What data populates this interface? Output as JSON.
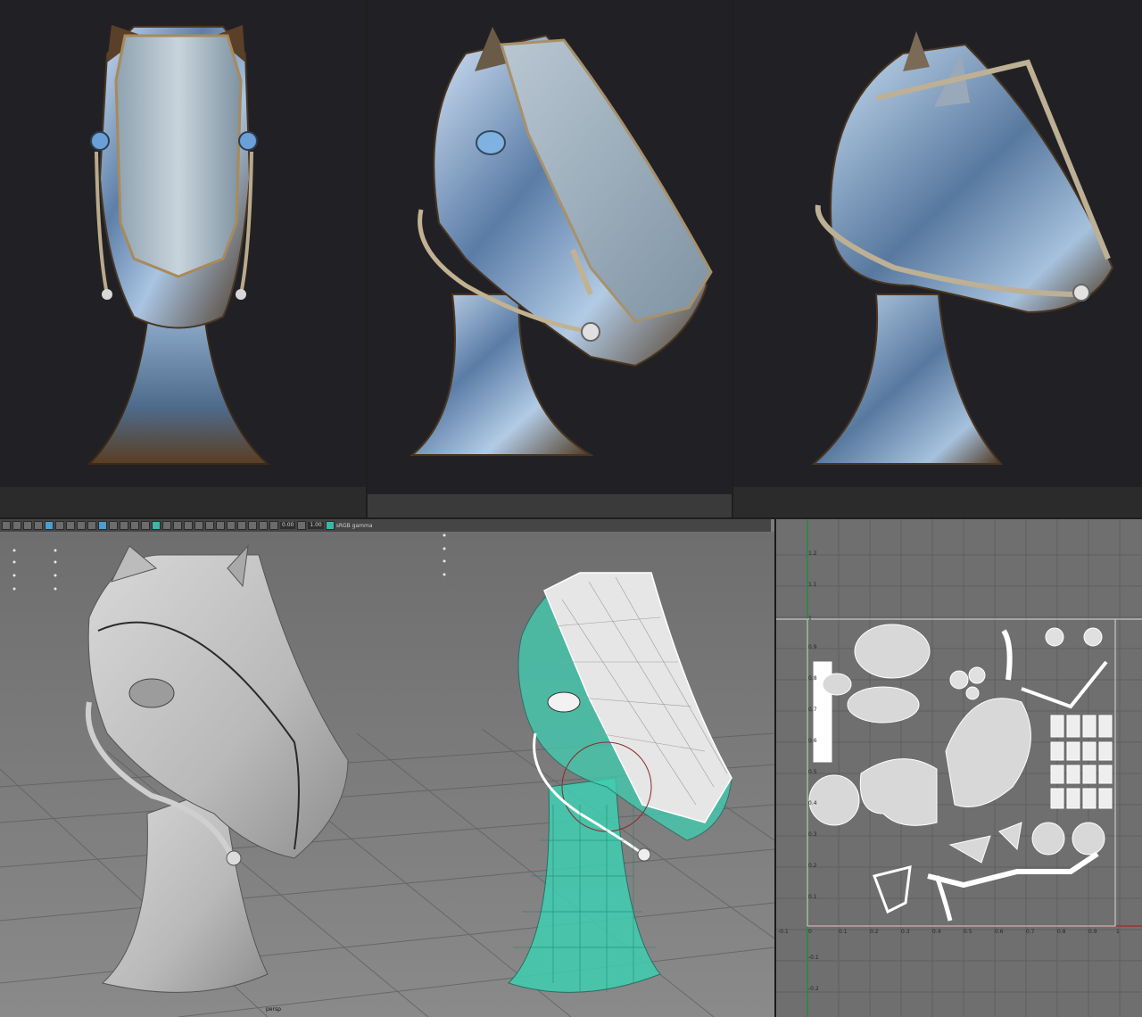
{
  "toolbar": {
    "field_exposure": "0.00",
    "field_gamma": "1.00",
    "color_space": "sRGB gamma"
  },
  "viewport": {
    "camera_label": "persp"
  },
  "uv_editor": {
    "v_ticks": [
      "1.2",
      "1.1",
      "1",
      "0.9",
      "0.8",
      "0.7",
      "0.6",
      "0.5",
      "0.4",
      "0.3",
      "0.2",
      "0.1",
      "-0.1",
      "-0.2"
    ],
    "u_ticks": [
      "-0.1",
      "0",
      "0.1",
      "0.2",
      "0.3",
      "0.4",
      "0.5",
      "0.6",
      "0.7",
      "0.8",
      "0.9",
      "1"
    ]
  },
  "colors": {
    "render_bg": "#212125",
    "viewport_bg": "#7c7c7c",
    "uv_bg": "#6f6f6f",
    "wire_green": "#3fcfb2",
    "chrome": "#9fb8d6",
    "bronze": "#6a4a2a"
  }
}
